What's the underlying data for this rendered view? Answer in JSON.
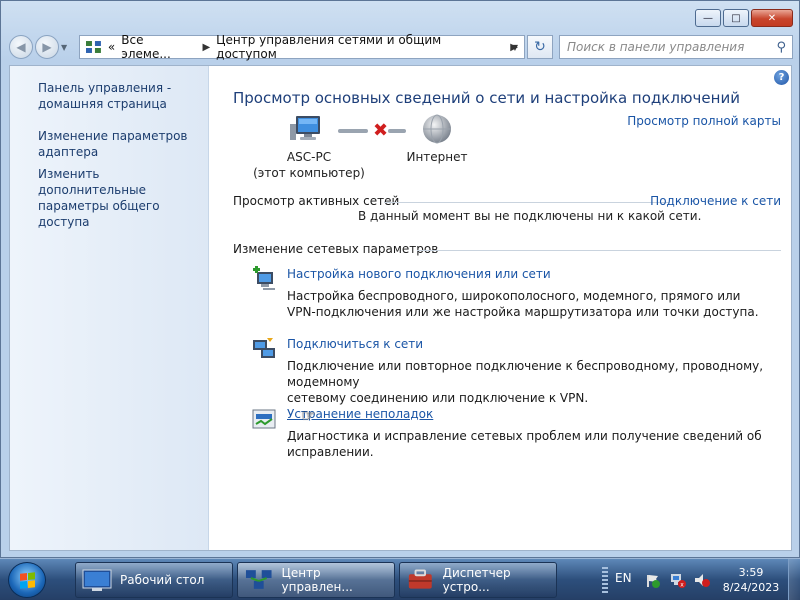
{
  "window": {
    "controls": {
      "minimize": "—",
      "maximize": "□",
      "close": "✕"
    }
  },
  "nav": {
    "back_icon": "back-arrow-icon",
    "forward_icon": "forward-arrow-icon",
    "address": {
      "chevron": "«",
      "crumb1": "Все элеме...",
      "crumb2": "Центр управления сетями и общим доступом"
    },
    "search_placeholder": "Поиск в панели управления"
  },
  "sidebar": {
    "items": [
      {
        "label1": "Панель управления -",
        "label2": "домашняя страница"
      },
      {
        "label1": "Изменение параметров",
        "label2": "адаптера"
      },
      {
        "label1": "Изменить дополнительные",
        "label2": "параметры общего доступа"
      }
    ]
  },
  "main": {
    "help": "?",
    "title": "Просмотр основных сведений о сети и настройка подключений",
    "full_map": "Просмотр полной карты",
    "pc_name": "ASC-PC",
    "pc_sub": "(этот компьютер)",
    "internet": "Интернет",
    "x_mark": "✖",
    "active_head": "Просмотр активных сетей",
    "connect_link": "Подключение к сети",
    "not_connected": "В данный момент вы не подключены ни к какой сети.",
    "change_head": "Изменение сетевых параметров",
    "tasks": [
      {
        "link": "Настройка нового подключения или сети",
        "desc1": "Настройка беспроводного, широкополосного, модемного, прямого или",
        "desc2": "VPN-подключения или же настройка маршрутизатора или точки доступа."
      },
      {
        "link": "Подключиться к сети",
        "desc1": "Подключение или повторное подключение к беспроводному, проводному, модемному",
        "desc2": "сетевому соединению или подключение к VPN."
      },
      {
        "link": "Устранение неполадок",
        "desc1": "Диагностика и исправление сетевых проблем или получение сведений об исправлении."
      }
    ]
  },
  "taskbar": {
    "buttons": [
      {
        "label": "Рабочий стол",
        "icon": "desktop-icon"
      },
      {
        "label": "Центр управлен...",
        "icon": "network-center-icon"
      },
      {
        "label": "Диспетчер устро...",
        "icon": "device-manager-icon"
      }
    ],
    "lang": "EN",
    "time": "3:59",
    "date": "8/24/2023"
  },
  "colors": {
    "link": "#1a55a6",
    "title": "#1e3f7a",
    "error_x": "#d01e1e"
  }
}
